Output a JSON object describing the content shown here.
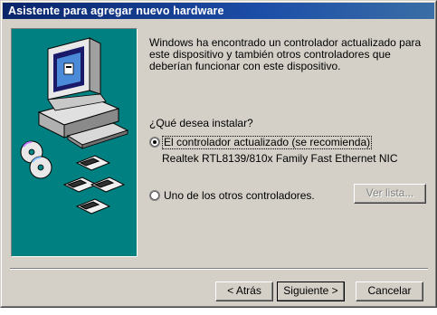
{
  "window": {
    "title": "Asistente para agregar nuevo hardware"
  },
  "content": {
    "intro": "Windows ha encontrado un controlador actualizado para este dispositivo y también otros controladores que deberían funcionar con este dispositivo.",
    "question": "¿Qué desea instalar?",
    "option1": {
      "label": "El controlador actualizado (se recomienda)",
      "selected": true
    },
    "device_name": "Realtek RTL8139/810x Family Fast Ethernet NIC",
    "option2": {
      "label": "Uno de los otros controladores.",
      "selected": false
    },
    "view_list_label": "Ver lista..."
  },
  "buttons": {
    "back": "< Atrás",
    "next": "Siguiente >",
    "cancel": "Cancelar"
  },
  "colors": {
    "title_bar": "#0a246a",
    "panel": "#008080",
    "window": "#d4d0c8"
  },
  "icons": [
    "computer-icon",
    "cd-icon",
    "disk-icon"
  ]
}
